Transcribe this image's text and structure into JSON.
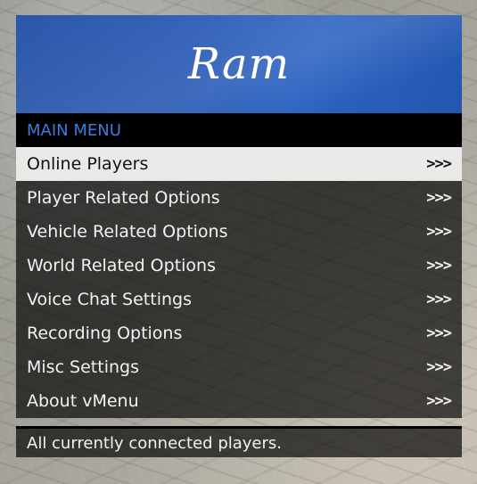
{
  "banner": {
    "title": "Ram"
  },
  "subtitle": "MAIN MENU",
  "items": [
    {
      "label": "Online Players",
      "arrow": ">>>",
      "selected": true
    },
    {
      "label": "Player Related Options",
      "arrow": ">>>"
    },
    {
      "label": "Vehicle Related Options",
      "arrow": ">>>"
    },
    {
      "label": "World Related Options",
      "arrow": ">>>"
    },
    {
      "label": "Voice Chat Settings",
      "arrow": ">>>"
    },
    {
      "label": "Recording Options",
      "arrow": ">>>"
    },
    {
      "label": "Misc Settings",
      "arrow": ">>>"
    },
    {
      "label": "About vMenu",
      "arrow": ">>>"
    }
  ],
  "description": "All currently connected players.",
  "colors": {
    "banner": "#2456b2",
    "subtitle_text": "#3b7bdf",
    "selected_bg": "#e9e9e7"
  }
}
